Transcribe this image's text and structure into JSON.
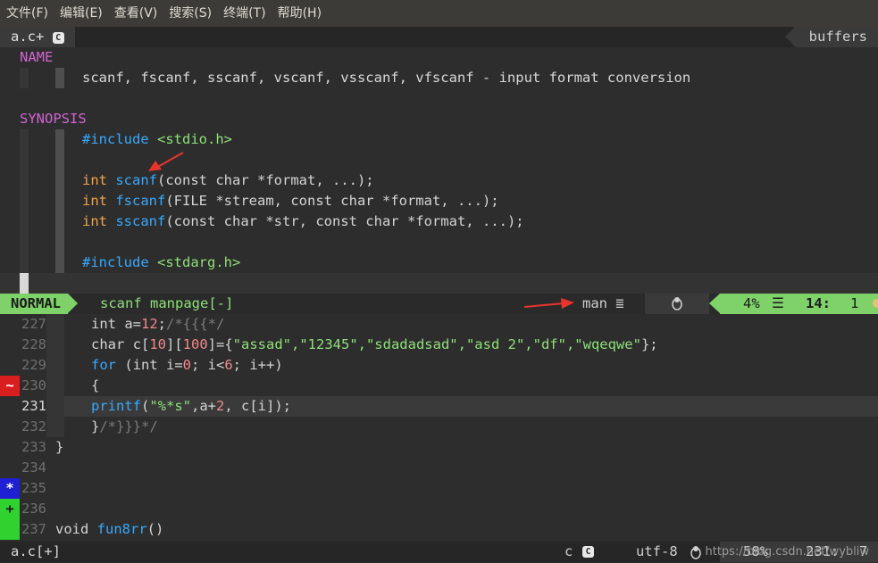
{
  "menubar": {
    "items": [
      "文件(F)",
      "编辑(E)",
      "查看(V)",
      "搜索(S)",
      "终端(T)",
      "帮助(H)"
    ]
  },
  "tabline": {
    "active_tab": "a.c+",
    "buffers_label": "buffers"
  },
  "manpage": {
    "name_heading": "NAME",
    "name_line": "scanf, fscanf, sscanf, vscanf, vsscanf, vfscanf - input format conversion",
    "synopsis_heading": "SYNOPSIS",
    "include1_kw": "#include",
    "include1_hdr": "<stdio.h>",
    "proto1_int": "int",
    "proto1_fn": "scanf",
    "proto1_args": "(const char *format, ...);",
    "proto2_int": "int",
    "proto2_fn": "fscanf",
    "proto2_args": "(FILE *stream, const char *format, ...);",
    "proto3_int": "int",
    "proto3_fn": "sscanf",
    "proto3_args": "(const char *str, const char *format, ...);",
    "include2_kw": "#include",
    "include2_hdr": "<stdarg.h>"
  },
  "statusline_top": {
    "mode": "NORMAL",
    "file": "scanf manpage[-]",
    "filetype": "man",
    "os_icon": "tux-icon",
    "percent": "4%",
    "line": "14:",
    "col": "1"
  },
  "code": {
    "lines": [
      {
        "n": "227",
        "sign": ""
      },
      {
        "n": "228",
        "sign": ""
      },
      {
        "n": "229",
        "sign": ""
      },
      {
        "n": "230",
        "sign": "~"
      },
      {
        "n": "231",
        "sign": ""
      },
      {
        "n": "232",
        "sign": ""
      },
      {
        "n": "233",
        "sign": ""
      },
      {
        "n": "234",
        "sign": ""
      },
      {
        "n": "235",
        "sign": "*"
      },
      {
        "n": "236",
        "sign": "+"
      },
      {
        "n": "237",
        "sign": ""
      }
    ],
    "l227_a": "int a=",
    "l227_num": "12",
    "l227_b": ";",
    "l227_cmt": "/*{{{*/",
    "l228_a": "char c[",
    "l228_n1": "10",
    "l228_b": "][",
    "l228_n2": "100",
    "l228_c": "]={",
    "l228_strs": "\"assad\",\"12345\",\"sdadadsad\",\"asd 2\",\"df\",\"wqeqwe\"",
    "l228_d": "};",
    "l229_kw": "for",
    "l229_a": " (int i=",
    "l229_n1": "0",
    "l229_b": "; i<",
    "l229_n2": "6",
    "l229_c": "; i++)",
    "l230": "{",
    "l231_fn": "printf",
    "l231_a": "(",
    "l231_str": "\"%*s\"",
    "l231_b": ",a+",
    "l231_num": "2",
    "l231_c": ", c[i]);",
    "l232_a": "}",
    "l232_cmt": "/*}}}*/",
    "l233": "}",
    "l237_a": "void ",
    "l237_fn": "fun8rr",
    "l237_b": "()"
  },
  "statusline_bottom": {
    "file": "a.c[+]",
    "filetype": "c",
    "encoding": "utf-8",
    "percent": "58%",
    "pos": "231:",
    "col": "7",
    "watermark": "https://blog.csdn.net/wybliw"
  },
  "colors": {
    "accent_green": "#7fd26a",
    "keyword_blue": "#37a9ff",
    "section_magenta": "#d363d3",
    "annotation_red": "#e8352b"
  }
}
